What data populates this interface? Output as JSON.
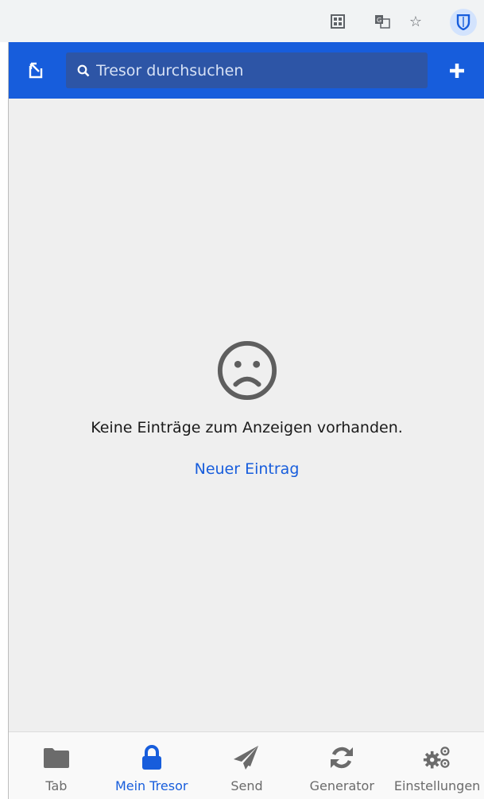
{
  "browser": {
    "toolbar_icons": [
      "qr-code-icon",
      "translate-icon",
      "star-bookmark-icon",
      "bitwarden-extension-icon"
    ]
  },
  "header": {
    "search_placeholder": "Tresor durchsuchen",
    "accent": "#175ddc"
  },
  "empty_state": {
    "icon": "frown-icon",
    "message": "Keine Einträge zum Anzeigen vorhanden.",
    "link": "Neuer Eintrag"
  },
  "tabs": [
    {
      "label": "Tab",
      "icon": "folder-icon",
      "active": false
    },
    {
      "label": "Mein Tresor",
      "icon": "lock-icon",
      "active": true
    },
    {
      "label": "Send",
      "icon": "paper-plane-icon",
      "active": false
    },
    {
      "label": "Generator",
      "icon": "refresh-icon",
      "active": false
    },
    {
      "label": "Einstellungen",
      "icon": "gears-icon",
      "active": false
    }
  ]
}
